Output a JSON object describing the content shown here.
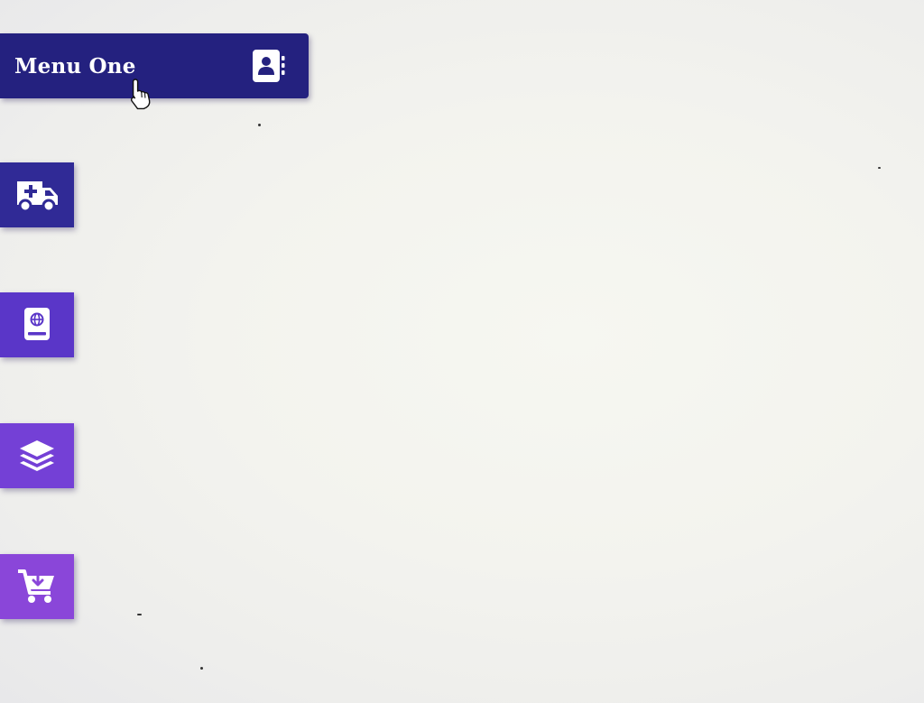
{
  "menu": {
    "items": [
      {
        "label": "Menu One",
        "icon": "contact-book-icon",
        "color": "#24217f",
        "state": "expanded"
      },
      {
        "label": "",
        "icon": "ambulance-icon",
        "color": "#302a96",
        "state": "collapsed"
      },
      {
        "label": "",
        "icon": "passport-icon",
        "color": "#5a36c8",
        "state": "collapsed"
      },
      {
        "label": "",
        "icon": "layers-icon",
        "color": "#7440d6",
        "state": "collapsed"
      },
      {
        "label": "",
        "icon": "cart-download-icon",
        "color": "#8a46d9",
        "state": "collapsed"
      }
    ]
  },
  "pointer": {
    "icon": "hand-pointer-icon"
  }
}
